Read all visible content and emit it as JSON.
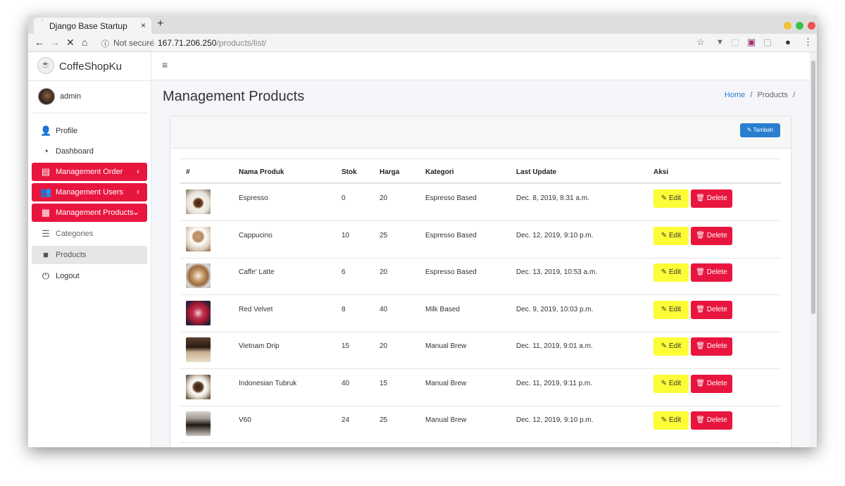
{
  "browser": {
    "tab_title": "Django Base Startup",
    "tab_close": "×",
    "new_tab": "+",
    "not_secure": "Not secure",
    "url_host": "167.71.206.250",
    "url_path": "/products/list/"
  },
  "sidebar": {
    "brand": "CoffeShopKu",
    "user": "admin",
    "items": [
      {
        "label": "Profile",
        "icon": "user-icon"
      },
      {
        "label": "Dashboard",
        "icon": "dashboard-icon"
      },
      {
        "label": "Management Order",
        "icon": "store-icon"
      },
      {
        "label": "Management Users",
        "icon": "users-icon"
      },
      {
        "label": "Management Products",
        "icon": "boxes-icon"
      },
      {
        "label": "Categories",
        "icon": "list-icon"
      },
      {
        "label": "Products",
        "icon": "bag-icon"
      },
      {
        "label": "Logout",
        "icon": "power-icon"
      }
    ]
  },
  "header": {
    "title": "Management Products"
  },
  "breadcrumb": {
    "home": "Home",
    "sep": "/",
    "current": "Products",
    "trail": "/"
  },
  "card": {
    "add_button": "Tambah"
  },
  "table": {
    "headers": [
      "#",
      "Nama Produk",
      "Stok",
      "Harga",
      "Kategori",
      "Last Update",
      "Aksi"
    ],
    "edit_label": "Edit",
    "delete_label": "Delete",
    "rows": [
      {
        "name": "Espresso",
        "stok": "0",
        "harga": "20",
        "kategori": "Espresso Based",
        "last_update": "Dec. 8, 2019, 8:31 a.m."
      },
      {
        "name": "Cappucino",
        "stok": "10",
        "harga": "25",
        "kategori": "Espresso Based",
        "last_update": "Dec. 12, 2019, 9:10 p.m."
      },
      {
        "name": "Caffe' Latte",
        "stok": "6",
        "harga": "20",
        "kategori": "Espresso Based",
        "last_update": "Dec. 13, 2019, 10:53 a.m."
      },
      {
        "name": "Red Velvet",
        "stok": "8",
        "harga": "40",
        "kategori": "Milk Based",
        "last_update": "Dec. 9, 2019, 10:03 p.m."
      },
      {
        "name": "Vietnam Drip",
        "stok": "15",
        "harga": "20",
        "kategori": "Manual Brew",
        "last_update": "Dec. 11, 2019, 9:01 a.m."
      },
      {
        "name": "Indonesian Tubruk",
        "stok": "40",
        "harga": "15",
        "kategori": "Manual Brew",
        "last_update": "Dec. 11, 2019, 9:11 p.m."
      },
      {
        "name": "V60",
        "stok": "24",
        "harga": "25",
        "kategori": "Manual Brew",
        "last_update": "Dec. 12, 2019, 9:10 p.m."
      }
    ]
  },
  "colors": {
    "accent_red": "#e8163f",
    "primary_blue": "#2a7fd0",
    "edit_yellow": "#fcfc37"
  }
}
